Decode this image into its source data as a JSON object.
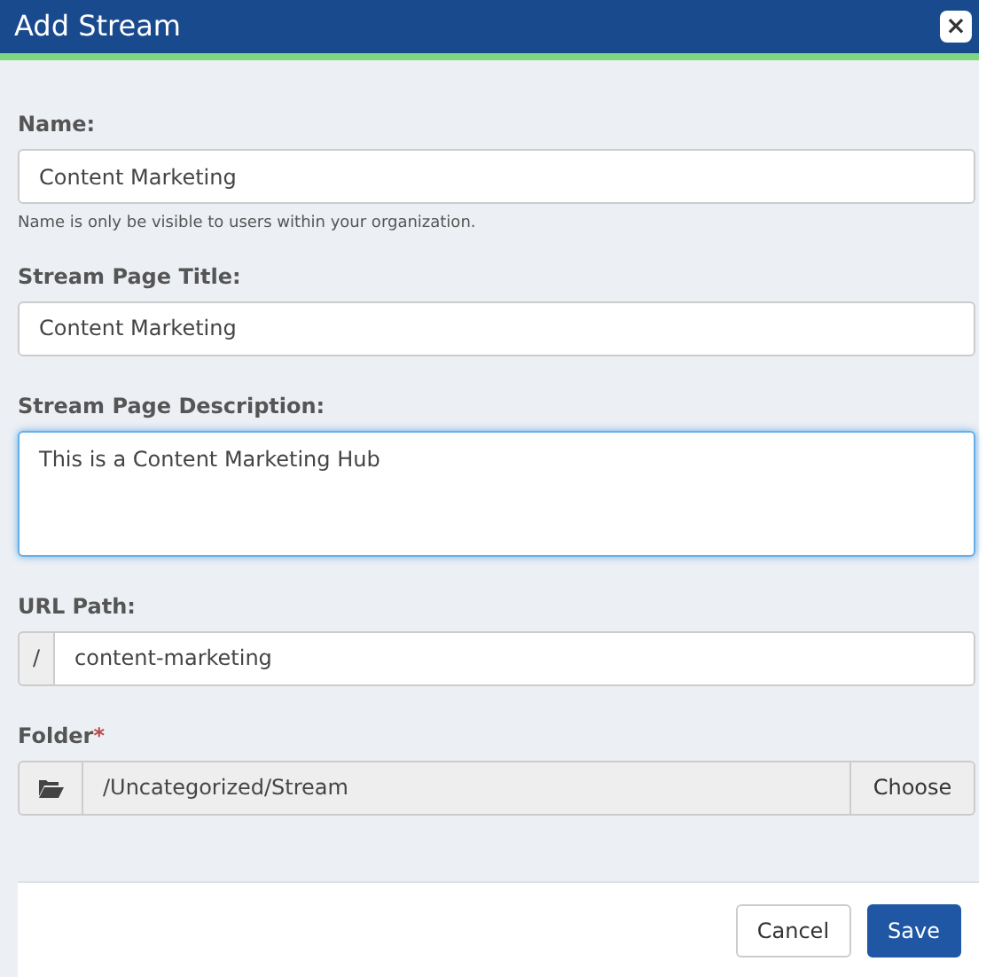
{
  "window": {
    "title": "Add Stream",
    "close": "×"
  },
  "fields": [
    {
      "kind": "text",
      "label": "Name:",
      "value": "Content Marketing",
      "hint": "Name is only be visible to users within your organization.",
      "focused": false
    },
    {
      "kind": "text",
      "label": "Stream Page Title:",
      "value": "Content Marketing",
      "focused": false
    },
    {
      "kind": "textarea",
      "label": "Stream Page Description:",
      "value": "This is a Content Marketing Hub",
      "focused": true
    },
    {
      "kind": "prefixed",
      "label": "URL Path:",
      "prefix": "/",
      "value": "content-marketing",
      "focused": false
    },
    {
      "kind": "folder",
      "label": "Folder",
      "required_mark": "*",
      "value": "/Uncategorized/Stream",
      "button": "Choose",
      "focused": false
    }
  ],
  "buttons": [
    {
      "label": "Cancel",
      "kind": "secondary"
    },
    {
      "label": "Save",
      "kind": "primary"
    }
  ]
}
